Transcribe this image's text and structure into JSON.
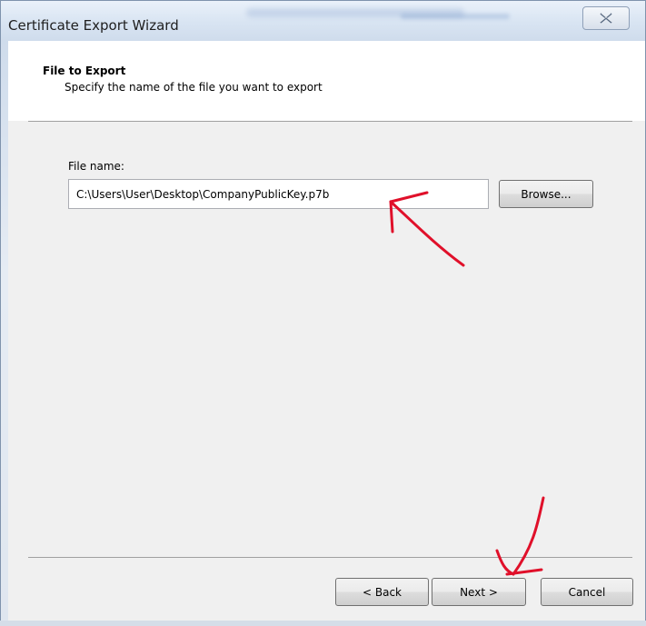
{
  "window": {
    "title": "Certificate Export Wizard",
    "close_icon": "close-icon"
  },
  "header": {
    "title": "File to Export",
    "subtitle": "Specify the name of the file you want to export"
  },
  "form": {
    "file_name_label": "File name:",
    "file_name_value": "C:\\Users\\User\\Desktop\\CompanyPublicKey.p7b",
    "browse_label": "Browse..."
  },
  "footer": {
    "back_label": "< Back",
    "next_label": "Next >",
    "cancel_label": "Cancel"
  },
  "annotations": {
    "arrow_color": "#e0102a"
  }
}
